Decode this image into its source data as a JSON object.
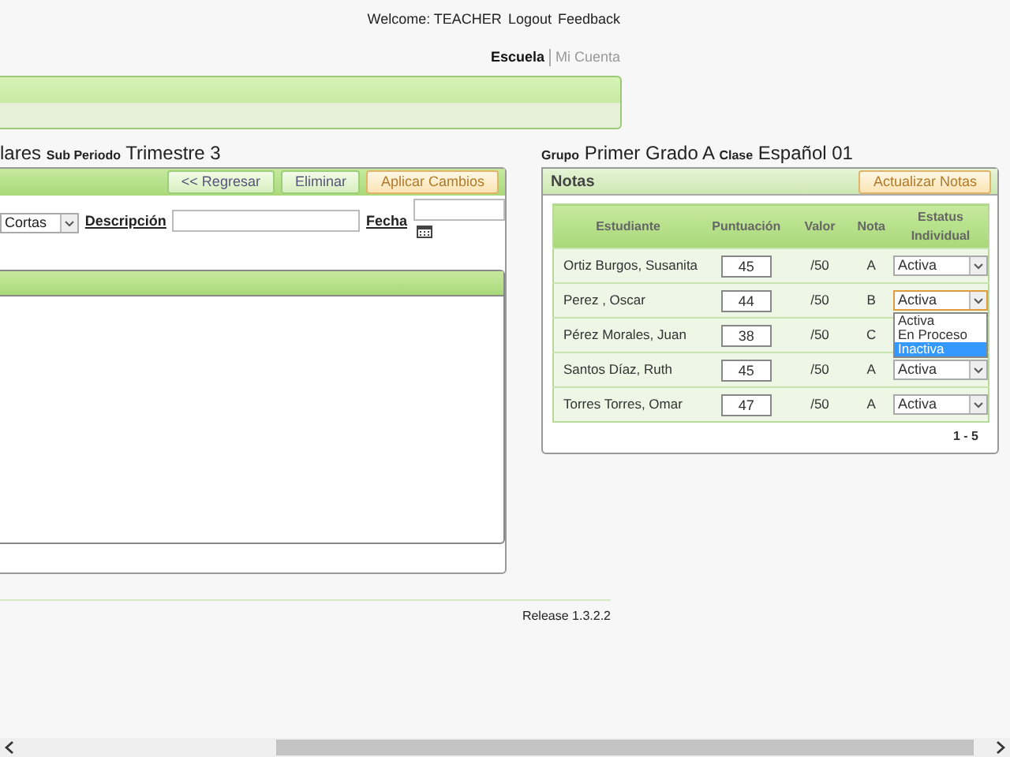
{
  "header": {
    "welcome": "Welcome: TEACHER",
    "links": [
      "Logout",
      "Feedback"
    ]
  },
  "nav": [
    {
      "label": "Escuela",
      "selected": true
    },
    {
      "label": "Mi Cuenta",
      "selected": false
    }
  ],
  "left": {
    "title_text": "lares",
    "sub_label": "Sub Periodo",
    "sub_value": "Trimestre 3",
    "buttons": [
      {
        "label": "<< Regresar",
        "kind": "normal"
      },
      {
        "label": "Eliminar",
        "kind": "normal"
      },
      {
        "label": "Aplicar Cambios",
        "kind": "primary"
      }
    ],
    "type_value": "Cortas",
    "description_label": "Descripción",
    "date_label": "Fecha"
  },
  "right": {
    "group_label": "Grupo",
    "group_value": "Primer Grado A",
    "class_label": "Clase",
    "class_value": "Español 01",
    "panel_title": "Notas",
    "update_button": "Actualizar Notas",
    "columns": [
      "Estudiante",
      "Puntuación",
      "Valor",
      "Nota",
      "Estatus Individual"
    ],
    "rows": [
      {
        "student": "Ortiz Burgos, Susanita",
        "score": "45",
        "value": "/50",
        "grade": "A",
        "status": "Activa",
        "open": false
      },
      {
        "student": "Perez , Oscar",
        "score": "44",
        "value": "/50",
        "grade": "B",
        "status": "Activa",
        "open": true
      },
      {
        "student": "Pérez Morales, Juan",
        "score": "38",
        "value": "/50",
        "grade": "C",
        "open": false
      },
      {
        "student": "Santos Díaz, Ruth",
        "score": "45",
        "value": "/50",
        "grade": "A",
        "status": "Activa",
        "open": false
      },
      {
        "student": "Torres Torres, Omar",
        "score": "47",
        "value": "/50",
        "grade": "A",
        "status": "Activa",
        "open": false
      }
    ],
    "dropdown_options": [
      {
        "label": "Activa",
        "highlighted": false
      },
      {
        "label": "En Proceso",
        "highlighted": false
      },
      {
        "label": "Inactiva",
        "highlighted": true
      }
    ],
    "pagination": "1 - 5"
  },
  "footer": {
    "release": "Release 1.3.2.2"
  }
}
